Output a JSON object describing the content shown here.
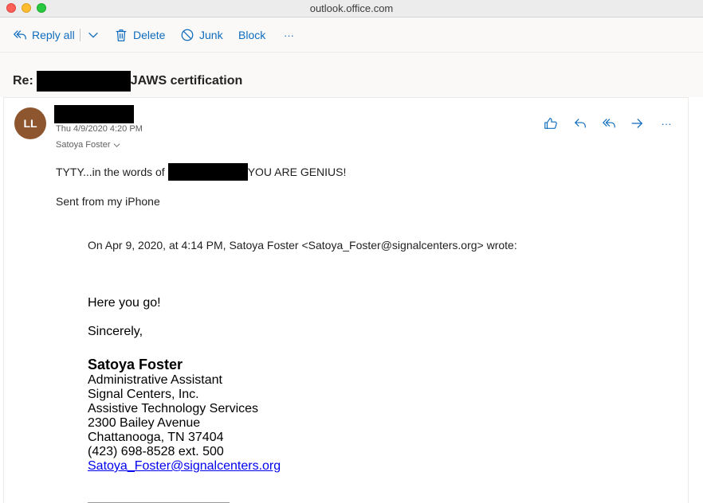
{
  "window": {
    "title": "outlook.office.com"
  },
  "toolbar": {
    "reply_all": "Reply all",
    "delete": "Delete",
    "junk": "Junk",
    "block": "Block",
    "more": "···"
  },
  "message": {
    "subject_prefix": "Re:",
    "subject_suffix": "JAWS certification",
    "sender_initials": "LL",
    "date": "Thu 4/9/2020 4:20 PM",
    "to": "Satoya Foster",
    "body_line1_prefix": "TYTY...in the words of",
    "body_line1_suffix": "YOU ARE GENIUS!",
    "sent_from": "Sent from my iPhone",
    "actions_more": "···"
  },
  "quoted": {
    "header": "On Apr 9, 2020, at 4:14 PM, Satoya Foster <Satoya_Foster@signalcenters.org> wrote:",
    "greeting": "Here you go!",
    "closing": "Sincerely,",
    "signature": {
      "name": "Satoya Foster",
      "title": "Administrative Assistant",
      "company": "Signal Centers, Inc.",
      "department": "Assistive Technology Services",
      "street": "2300 Bailey Avenue",
      "city": "Chattanooga, TN 37404",
      "phone": "(423) 698-8528 ext. 500",
      "email": "Satoya_Foster@signalcenters.org"
    }
  },
  "colors": {
    "accent": "#0f6cbd",
    "avatar": "#8e562e",
    "link": "#0000ee"
  }
}
